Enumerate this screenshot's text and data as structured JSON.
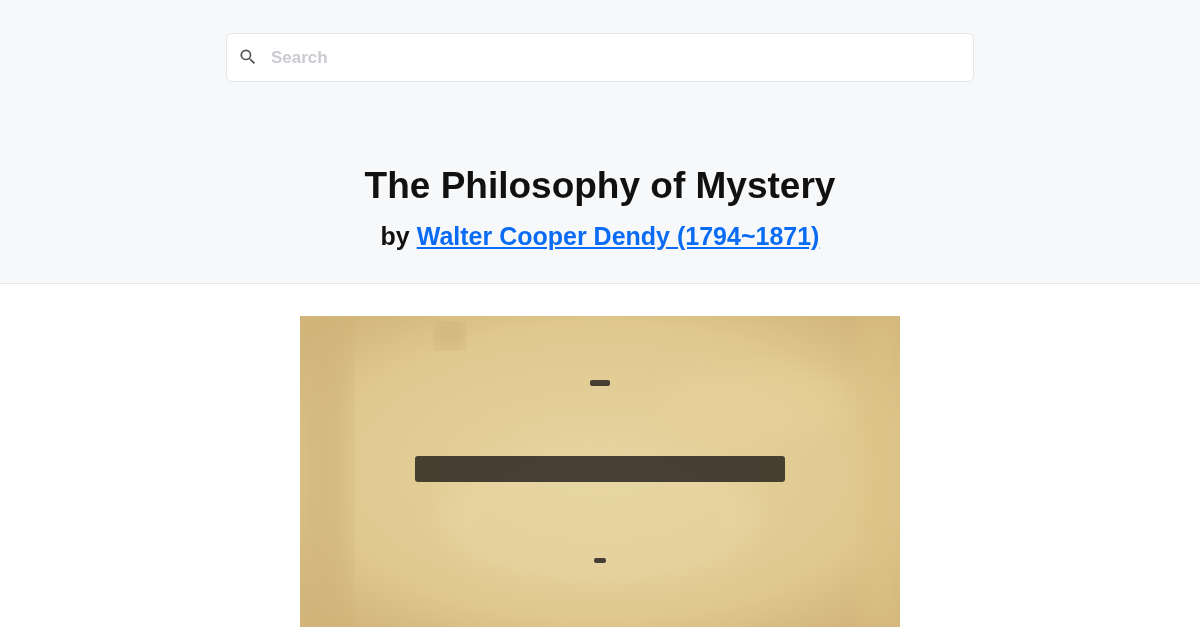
{
  "search": {
    "placeholder": "Search"
  },
  "book": {
    "title": "The Philosophy of Mystery",
    "byline_prefix": "by",
    "author": "Walter Cooper Dendy (1794~1871)"
  }
}
